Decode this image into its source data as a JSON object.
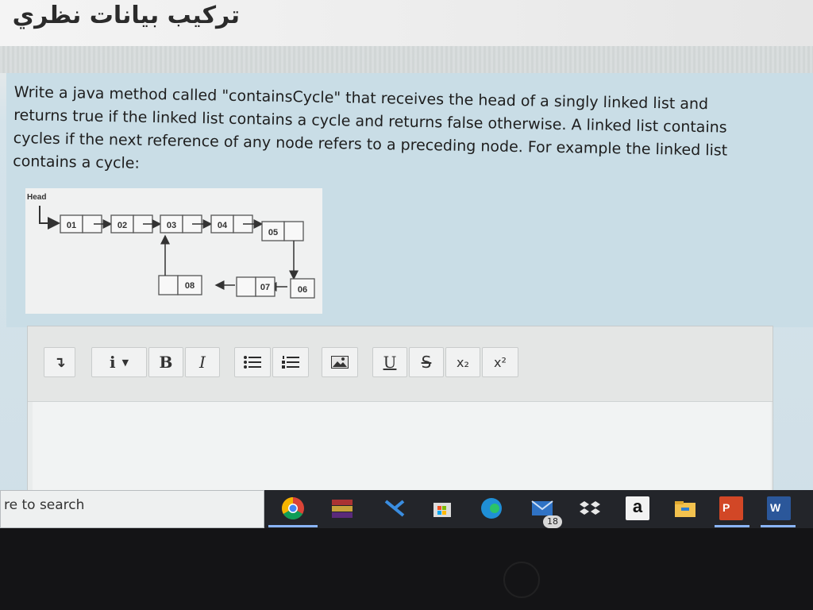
{
  "page": {
    "title": "تركيب بيانات نظري"
  },
  "question": {
    "lines": [
      "Write a java method called \"containsCycle\" that receives  the head of a singly linked list and",
      "returns true if the linked list contains a cycle and returns false otherwise. A linked list contains",
      "cycles if the next reference of any node refers to  a preceding node. For example the linked list",
      "contains a cycle:"
    ]
  },
  "diagram": {
    "head_label": "Head",
    "top_nodes": [
      "01",
      "02",
      "03",
      "04",
      "05"
    ],
    "bottom_nodes": [
      "08",
      "07",
      "06"
    ]
  },
  "toolbar": {
    "paragraph_icon": "↴",
    "info_icon": "i",
    "bold": "B",
    "italic": "I",
    "underline": "U",
    "strike": "S",
    "subscript": "x₂",
    "superscript": "x²"
  },
  "taskbar": {
    "search_text": "re to search",
    "mail_badge": "18",
    "amazon_letter": "a",
    "powerpoint_letter": "P",
    "word_letter": "W"
  }
}
